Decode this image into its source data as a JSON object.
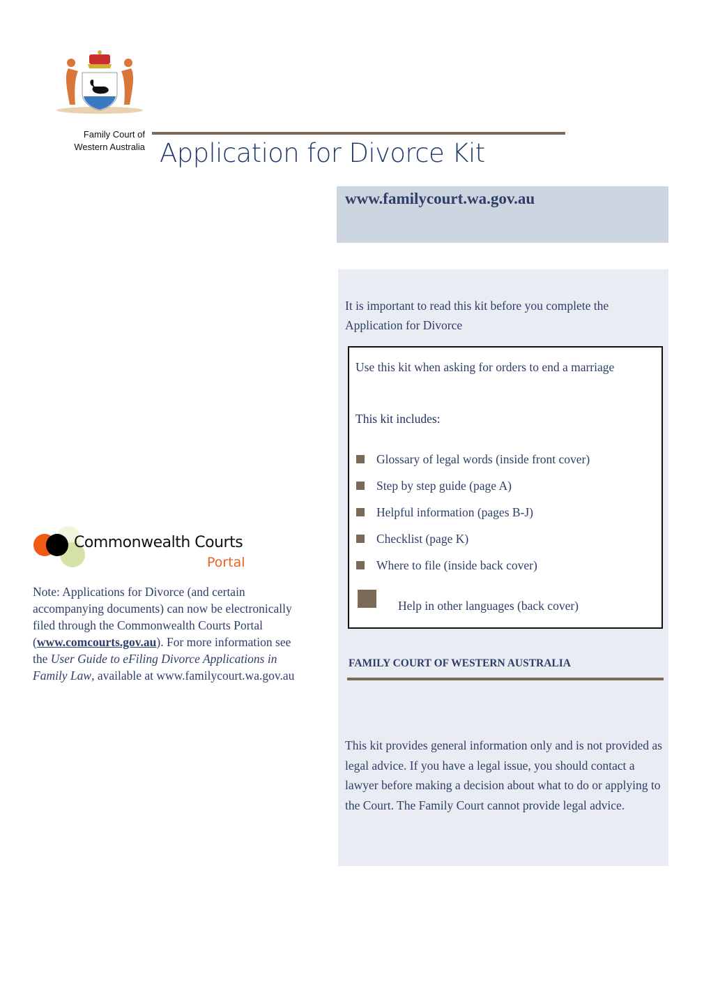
{
  "header": {
    "crest_caption_line1": "Family Court of",
    "crest_caption_line2": "Western Australia",
    "title": "Application for Divorce Kit",
    "website": "www.familycourt.wa.gov.au"
  },
  "intro": {
    "text": "It is important to read this kit before you complete the Application for Divorce"
  },
  "includes_box": {
    "use_text": "Use this kit when asking for orders to end a marriage",
    "heading": "This kit includes:",
    "items": [
      "Glossary of legal words (inside front cover)",
      "Step by step guide (page A)",
      "Helpful information (pages B-J)",
      "Checklist (page K)",
      "Where to file (inside back cover)"
    ],
    "help_item": "Help in other languages (back cover)"
  },
  "footer_panel": {
    "org_heading": "FAMILY COURT OF WESTERN AUSTRALIA",
    "disclaimer": "This kit provides general information only and is not provided as legal advice. If you have a legal issue, you should contact a lawyer before making a decision about what to do or applying to the Court. The Family Court cannot provide legal advice."
  },
  "portal": {
    "logo_name": "Commonwealth Courts",
    "logo_sub": "Portal",
    "note_start": "Note: Applications for Divorce (and certain accompanying documents) can now be electronically filed through the Commonwealth Courts Portal (",
    "note_link": "www.comcourts.gov.au",
    "note_mid": "). For more information see the ",
    "note_guide": "User Guide to eFiling Divorce Applications in Family Law",
    "note_end": ", available at www.familycourt.wa.gov.au"
  },
  "colors": {
    "text_navy": "#2e3e68",
    "accent_brown": "#7b6a57",
    "url_panel_bg": "#cdd5e0",
    "main_panel_bg": "#e9ecf2",
    "portal_orange": "#f06020"
  }
}
